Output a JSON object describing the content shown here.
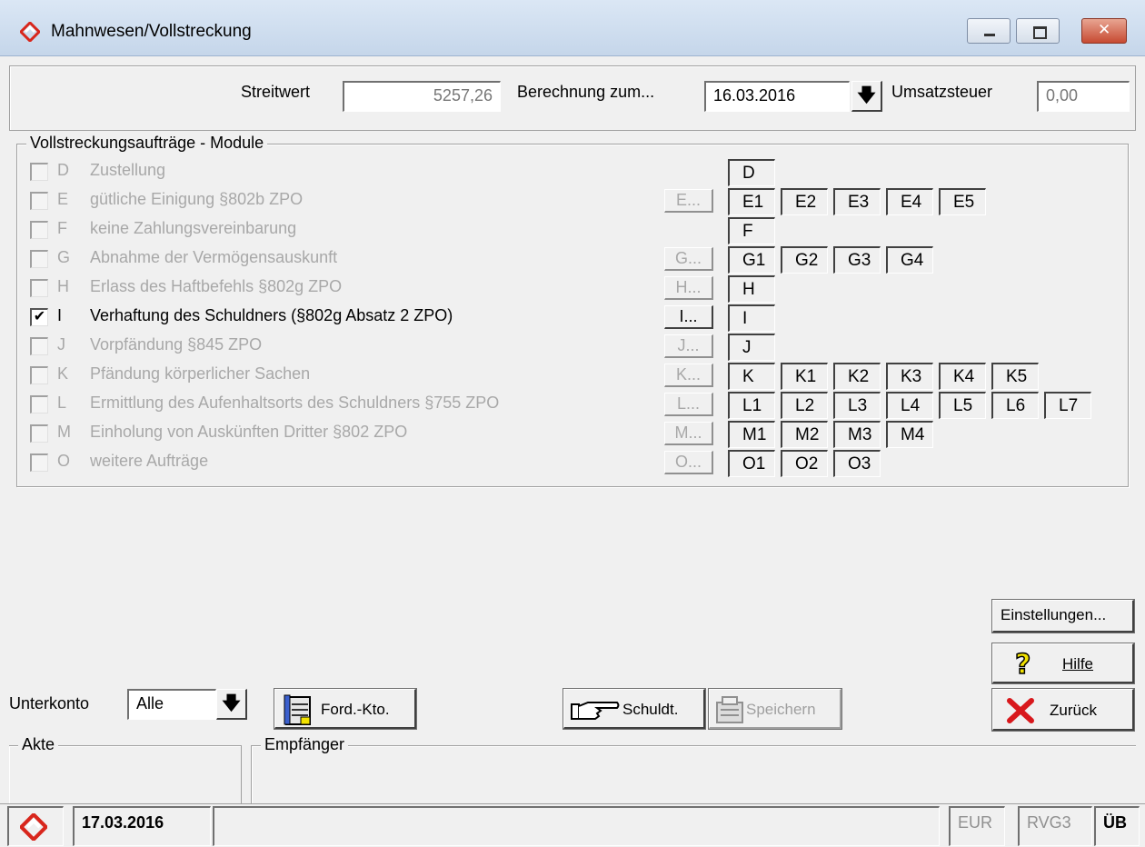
{
  "window": {
    "title": "Mahnwesen/Vollstreckung"
  },
  "header": {
    "streitwert_label": "Streitwert",
    "streitwert_value": "5257,26",
    "berechnung_label": "Berechnung zum...",
    "berechnung_value": "16.03.2016",
    "umsatzsteuer_label": "Umsatzsteuer",
    "umsatzsteuer_value": "0,00"
  },
  "group": {
    "title": "Vollstreckungsaufträge - Module",
    "rows": [
      {
        "letter": "D",
        "text": "Zustellung",
        "checked": false,
        "button": "",
        "modules": [
          "D"
        ]
      },
      {
        "letter": "E",
        "text": "gütliche Einigung §802b ZPO",
        "checked": false,
        "button": "E...",
        "modules": [
          "E1",
          "E2",
          "E3",
          "E4",
          "E5"
        ]
      },
      {
        "letter": "F",
        "text": "keine Zahlungsvereinbarung",
        "checked": false,
        "button": "",
        "modules": [
          "F"
        ]
      },
      {
        "letter": "G",
        "text": "Abnahme der Vermögensauskunft",
        "checked": false,
        "button": "G...",
        "modules": [
          "G1",
          "G2",
          "G3",
          "G4"
        ]
      },
      {
        "letter": "H",
        "text": "Erlass des Haftbefehls §802g ZPO",
        "checked": false,
        "button": "H...",
        "modules": [
          "H"
        ]
      },
      {
        "letter": "I",
        "text": "Verhaftung des Schuldners (§802g Absatz 2 ZPO)",
        "checked": true,
        "button": "I...",
        "modules": [
          "I"
        ]
      },
      {
        "letter": "J",
        "text": "Vorpfändung §845 ZPO",
        "checked": false,
        "button": "J...",
        "modules": [
          "J"
        ]
      },
      {
        "letter": "K",
        "text": "Pfändung körperlicher Sachen",
        "checked": false,
        "button": "K...",
        "modules": [
          "K",
          "K1",
          "K2",
          "K3",
          "K4",
          "K5"
        ]
      },
      {
        "letter": "L",
        "text": "Ermittlung des Aufenhaltsorts des Schuldners §755 ZPO",
        "checked": false,
        "button": "L...",
        "modules": [
          "L1",
          "L2",
          "L3",
          "L4",
          "L5",
          "L6",
          "L7"
        ]
      },
      {
        "letter": "M",
        "text": "Einholung von Auskünften Dritter §802 ZPO",
        "checked": false,
        "button": "M...",
        "modules": [
          "M1",
          "M2",
          "M3",
          "M4"
        ]
      },
      {
        "letter": "O",
        "text": "weitere Aufträge",
        "checked": false,
        "button": "O...",
        "modules": [
          "O1",
          "O2",
          "O3"
        ]
      }
    ]
  },
  "buttons": {
    "einstellungen": "Einstellungen...",
    "hilfe": "Hilfe",
    "zurueck": "Zurück",
    "schuldt": "Schuldt.",
    "speichern": "Speichern",
    "ford_kto": "Ford.-Kto."
  },
  "unterkonto": {
    "label": "Unterkonto",
    "value": "Alle"
  },
  "bottom": {
    "akte_label": "Akte",
    "empfaenger_label": "Empfänger"
  },
  "statusbar": {
    "date": "17.03.2016",
    "currency": "EUR",
    "rvg": "RVG3",
    "ub": "ÜB"
  }
}
